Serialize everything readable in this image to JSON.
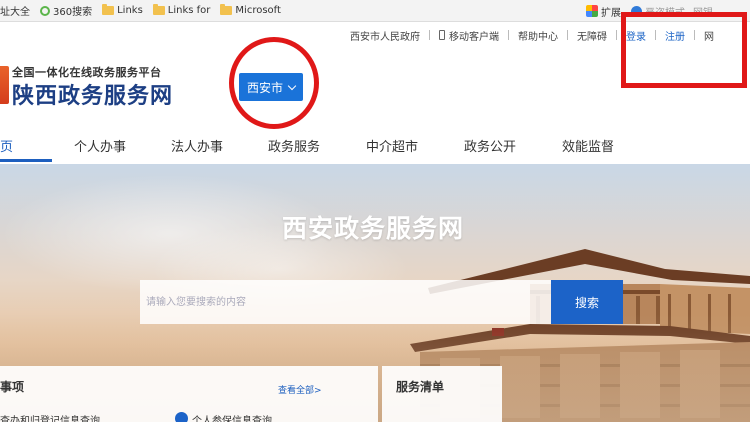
{
  "bookmarks": {
    "items": [
      {
        "label": "址大全",
        "icon": "folder-icon"
      },
      {
        "label": "360搜索",
        "icon": "360-icon"
      },
      {
        "label": "Links",
        "icon": "folder-icon"
      },
      {
        "label": "Links for",
        "icon": "folder-icon"
      },
      {
        "label": "Microsoft",
        "icon": "folder-icon"
      }
    ],
    "right": {
      "extensions_label": "扩展",
      "faded1": "严盗模式",
      "faded2": "网银"
    }
  },
  "toplinks": {
    "gov": "西安市人民政府",
    "mobile": "移动客户端",
    "help": "帮助中心",
    "accessible": "无障碍",
    "login": "登录",
    "register": "注册",
    "extra": "网"
  },
  "logo": {
    "subtitle": "全国一体化在线政务服务平台",
    "title": "陕西政务服务网"
  },
  "city": {
    "selected": "西安市"
  },
  "nav": {
    "items": [
      "页",
      "个人办事",
      "法人办事",
      "政务服务",
      "中介超市",
      "政务公开",
      "效能监督"
    ],
    "active_index": 0
  },
  "hero": {
    "title": "西安政务服务网",
    "search_placeholder": "请输入您要搜索的内容",
    "search_button": "搜索"
  },
  "bottom": {
    "left_title": "事项",
    "view_all": "查看全部>",
    "right_title": "服务清单",
    "row1": "查办和归登记信息查询",
    "row2": "个人参保信息查询"
  },
  "colors": {
    "brand_blue": "#1a73d9",
    "annotation_red": "#e01818"
  }
}
